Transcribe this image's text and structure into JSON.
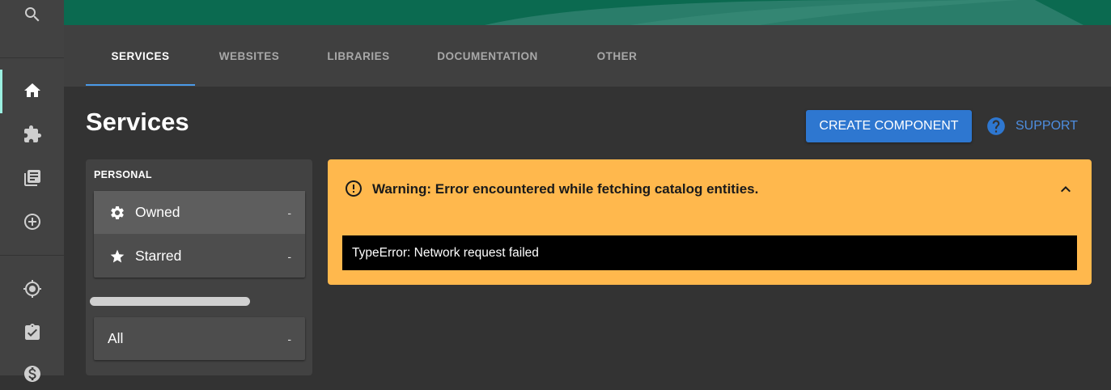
{
  "tabs": [
    {
      "label": "SERVICES",
      "active": true
    },
    {
      "label": "WEBSITES",
      "active": false
    },
    {
      "label": "LIBRARIES",
      "active": false
    },
    {
      "label": "DOCUMENTATION",
      "active": false
    },
    {
      "label": "OTHER",
      "active": false
    }
  ],
  "page": {
    "title": "Services",
    "create_button": "CREATE COMPONENT",
    "support_button": "SUPPORT"
  },
  "filters": {
    "personal_heading": "PERSONAL",
    "owned": {
      "label": "Owned",
      "count": "-"
    },
    "starred": {
      "label": "Starred",
      "count": "-"
    },
    "all": {
      "label": "All",
      "count": "-"
    }
  },
  "warning": {
    "title": "Warning: Error encountered while fetching catalog entities.",
    "detail": "TypeError: Network request failed"
  },
  "sidenav_icons": [
    "search-icon",
    "home-icon",
    "puzzle-icon",
    "library-icon",
    "add-circle-icon",
    "crosshair-icon",
    "assignment-check-icon",
    "dollar-icon"
  ],
  "colors": {
    "accent": "#2e77d0",
    "warning": "#ffb84d",
    "tab_indicator": "#4a9ae8",
    "header": "#0c6b52",
    "support": "#4e8ee0"
  }
}
